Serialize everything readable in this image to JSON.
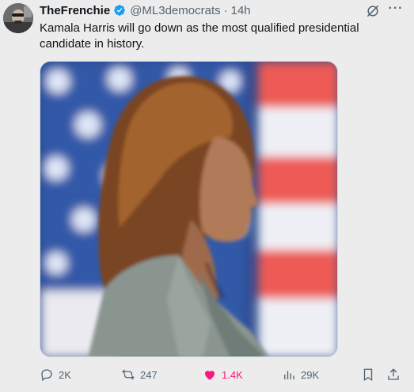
{
  "tweet": {
    "display_name": "TheFrenchie",
    "handle": "@ML3democrats",
    "separator": "·",
    "time": "14h",
    "text": "Kamala Harris will go down as the most qualified presidential candidate in history.",
    "verified": true,
    "more_label": "···"
  },
  "actions": {
    "replies": "2K",
    "reposts": "247",
    "likes": "1.4K",
    "views": "29K"
  },
  "icons": {
    "verified": "verified-badge-icon",
    "grok": "grok-icon",
    "more": "more-options-icon",
    "reply": "reply-icon",
    "repost": "repost-icon",
    "like": "heart-icon",
    "views": "views-icon",
    "bookmark": "bookmark-icon",
    "share": "share-icon"
  },
  "colors": {
    "verified": "#1d9bf0",
    "like": "#f91880",
    "muted": "#536471"
  }
}
